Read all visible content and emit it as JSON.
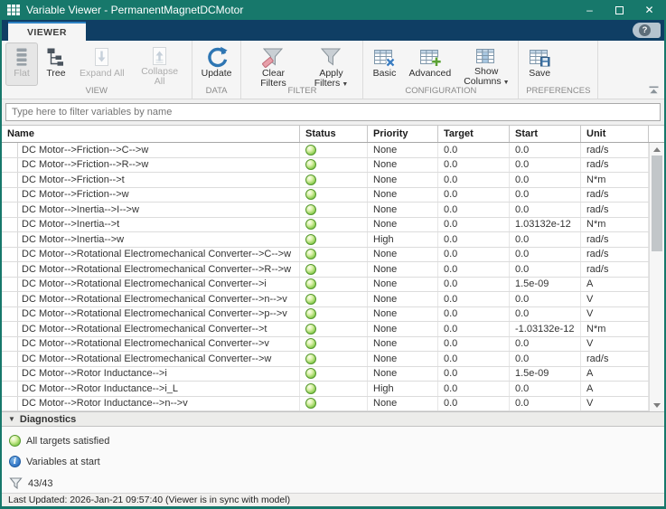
{
  "window": {
    "title": "Variable Viewer - PermanentMagnetDCMotor",
    "controls": {
      "minimize_glyph": "–",
      "close_glyph": "✕"
    }
  },
  "ribbon": {
    "tab": "VIEWER",
    "help_glyph": "?",
    "dropdown_arrow": "▼",
    "groups": [
      {
        "label": "VIEW",
        "buttons": [
          {
            "label": "Flat",
            "icon": "flat-icon",
            "disabled": true,
            "selected": true
          },
          {
            "label": "Tree",
            "icon": "tree-icon"
          },
          {
            "label": "Expand All",
            "icon": "expand-all-icon",
            "disabled": true
          },
          {
            "label": "Collapse All",
            "icon": "collapse-all-icon",
            "disabled": true
          }
        ]
      },
      {
        "label": "DATA",
        "buttons": [
          {
            "label": "Update",
            "icon": "update-icon"
          }
        ]
      },
      {
        "label": "FILTER",
        "buttons": [
          {
            "label": "Clear Filters",
            "icon": "clear-filters-icon"
          },
          {
            "label": "Apply Filters",
            "icon": "apply-filters-icon",
            "dropdown": true
          }
        ]
      },
      {
        "label": "CONFIGURATION",
        "buttons": [
          {
            "label": "Basic",
            "icon": "basic-icon"
          },
          {
            "label": "Advanced",
            "icon": "advanced-icon"
          },
          {
            "label": "Show Columns",
            "icon": "show-columns-icon",
            "dropdown": true
          }
        ]
      },
      {
        "label": "PREFERENCES",
        "buttons": [
          {
            "label": "Save",
            "icon": "save-icon"
          }
        ]
      }
    ]
  },
  "filter": {
    "placeholder": "Type here to filter variables by name"
  },
  "table": {
    "columns": [
      "Name",
      "Status",
      "Priority",
      "Target",
      "Start",
      "Unit"
    ],
    "rows": [
      {
        "name": "DC Motor-->Friction-->C-->w",
        "status": "ok",
        "priority": "None",
        "target": "0.0",
        "start": "0.0",
        "unit": "rad/s"
      },
      {
        "name": "DC Motor-->Friction-->R-->w",
        "status": "ok",
        "priority": "None",
        "target": "0.0",
        "start": "0.0",
        "unit": "rad/s"
      },
      {
        "name": "DC Motor-->Friction-->t",
        "status": "ok",
        "priority": "None",
        "target": "0.0",
        "start": "0.0",
        "unit": "N*m"
      },
      {
        "name": "DC Motor-->Friction-->w",
        "status": "ok",
        "priority": "None",
        "target": "0.0",
        "start": "0.0",
        "unit": "rad/s"
      },
      {
        "name": "DC Motor-->Inertia-->I-->w",
        "status": "ok",
        "priority": "None",
        "target": "0.0",
        "start": "0.0",
        "unit": "rad/s"
      },
      {
        "name": "DC Motor-->Inertia-->t",
        "status": "ok",
        "priority": "None",
        "target": "0.0",
        "start": "1.03132e-12",
        "unit": "N*m"
      },
      {
        "name": "DC Motor-->Inertia-->w",
        "status": "ok",
        "priority": "High",
        "target": "0.0",
        "start": "0.0",
        "unit": "rad/s"
      },
      {
        "name": "DC Motor-->Rotational Electromechanical Converter-->C-->w",
        "status": "ok",
        "priority": "None",
        "target": "0.0",
        "start": "0.0",
        "unit": "rad/s"
      },
      {
        "name": "DC Motor-->Rotational Electromechanical Converter-->R-->w",
        "status": "ok",
        "priority": "None",
        "target": "0.0",
        "start": "0.0",
        "unit": "rad/s"
      },
      {
        "name": "DC Motor-->Rotational Electromechanical Converter-->i",
        "status": "ok",
        "priority": "None",
        "target": "0.0",
        "start": "1.5e-09",
        "unit": "A"
      },
      {
        "name": "DC Motor-->Rotational Electromechanical Converter-->n-->v",
        "status": "ok",
        "priority": "None",
        "target": "0.0",
        "start": "0.0",
        "unit": "V"
      },
      {
        "name": "DC Motor-->Rotational Electromechanical Converter-->p-->v",
        "status": "ok",
        "priority": "None",
        "target": "0.0",
        "start": "0.0",
        "unit": "V"
      },
      {
        "name": "DC Motor-->Rotational Electromechanical Converter-->t",
        "status": "ok",
        "priority": "None",
        "target": "0.0",
        "start": "-1.03132e-12",
        "unit": "N*m"
      },
      {
        "name": "DC Motor-->Rotational Electromechanical Converter-->v",
        "status": "ok",
        "priority": "None",
        "target": "0.0",
        "start": "0.0",
        "unit": "V"
      },
      {
        "name": "DC Motor-->Rotational Electromechanical Converter-->w",
        "status": "ok",
        "priority": "None",
        "target": "0.0",
        "start": "0.0",
        "unit": "rad/s"
      },
      {
        "name": "DC Motor-->Rotor Inductance-->i",
        "status": "ok",
        "priority": "None",
        "target": "0.0",
        "start": "1.5e-09",
        "unit": "A"
      },
      {
        "name": "DC Motor-->Rotor Inductance-->i_L",
        "status": "ok",
        "priority": "High",
        "target": "0.0",
        "start": "0.0",
        "unit": "A"
      },
      {
        "name": "DC Motor-->Rotor Inductance-->n-->v",
        "status": "ok",
        "priority": "None",
        "target": "0.0",
        "start": "0.0",
        "unit": "V"
      }
    ]
  },
  "diagnostics": {
    "title": "Diagnostics",
    "collapse_glyph": "▼",
    "items": [
      {
        "icon": "status-ok-icon",
        "label": "All targets satisfied"
      },
      {
        "icon": "info-icon",
        "label": "Variables at start"
      },
      {
        "icon": "filter-count-icon",
        "label": "43/43"
      }
    ]
  },
  "status_bar": {
    "text": "Last Updated: 2026-Jan-21 09:57:40 (Viewer is in sync with model)"
  }
}
